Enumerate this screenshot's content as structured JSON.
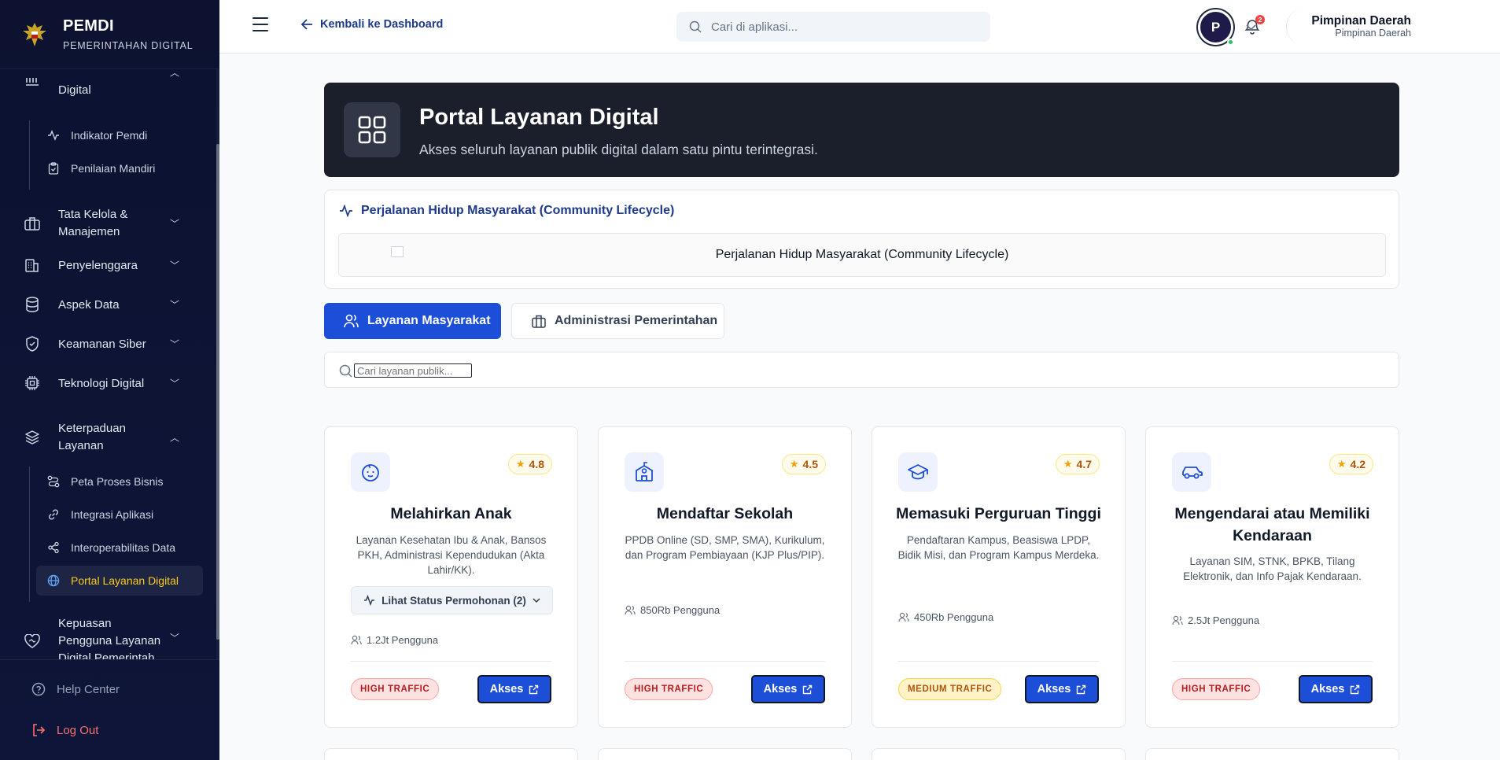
{
  "brand": {
    "name": "PEMDI",
    "subtitle": "PEMERINTAHAN DIGITAL"
  },
  "sidebar": {
    "partial_group": "Digital",
    "sub_group_1": [
      "Indikator Pemdi",
      "Penilaian Mandiri"
    ],
    "groups": {
      "tata_kelola": "Tata Kelola & Manajemen",
      "penyelenggara": "Penyelenggara",
      "aspek_data": "Aspek Data",
      "keamanan_siber": "Keamanan Siber",
      "teknologi_digital": "Teknologi Digital",
      "keterpaduan": "Keterpaduan Layanan",
      "kepuasan": "Kepuasan Pengguna Layanan Digital Pemerintah"
    },
    "sub_group_2": [
      "Peta Proses Bisnis",
      "Integrasi Aplikasi",
      "Interoperabilitas Data",
      "Portal Layanan Digital"
    ],
    "help": "Help Center",
    "logout": "Log Out"
  },
  "topbar": {
    "back_label": "Kembali ke Dashboard",
    "search_placeholder": "Cari di aplikasi...",
    "notif_count": "2",
    "user_name": "Pimpinan Daerah",
    "user_role": "Pimpinan Daerah",
    "avatar_initial": "P"
  },
  "hero": {
    "title": "Portal Layanan Digital",
    "subtitle": "Akses seluruh layanan publik digital dalam satu pintu terintegrasi."
  },
  "lifecycle": {
    "title": "Perjalanan Hidup Masyarakat (Community Lifecycle)",
    "image_alt": "Perjalanan Hidup Masyarakat (Community Lifecycle)"
  },
  "tabs": {
    "active": "Layanan Masyarakat",
    "other": "Administrasi Pemerintahan"
  },
  "service_search": {
    "placeholder": "Cari layanan publik..."
  },
  "colors": {
    "primary": "#1d4ed8",
    "sidebar": "#0c1230",
    "active_nav": "#facc15",
    "hero": "#1b1f2b"
  },
  "cards": [
    {
      "icon": "baby-icon",
      "rating": "4.8",
      "title": "Melahirkan Anak",
      "description": "Layanan Kesehatan Ibu & Anak, Bansos PKH, Administrasi Kependudukan (Akta Lahir/KK).",
      "status_button": "Lihat Status Permohonan (2)",
      "users": "1.2Jt Pengguna",
      "traffic": "HIGH TRAFFIC",
      "action": "Akses"
    },
    {
      "icon": "school-icon",
      "rating": "4.5",
      "title": "Mendaftar Sekolah",
      "description": "PPDB Online (SD, SMP, SMA), Kurikulum, dan Program Pembiayaan (KJP Plus/PIP).",
      "users": "850Rb Pengguna",
      "traffic": "HIGH TRAFFIC",
      "action": "Akses"
    },
    {
      "icon": "graduation-cap-icon",
      "rating": "4.7",
      "title": "Memasuki Perguruan Tinggi",
      "description": "Pendaftaran Kampus, Beasiswa LPDP, Bidik Misi, dan Program Kampus Merdeka.",
      "users": "450Rb Pengguna",
      "traffic": "MEDIUM TRAFFIC",
      "action": "Akses"
    },
    {
      "icon": "car-icon",
      "rating": "4.2",
      "title": "Mengendarai atau Memiliki Kendaraan",
      "description": "Layanan SIM, STNK, BPKB, Tilang Elektronik, dan Info Pajak Kendaraan.",
      "users": "2.5Jt Pengguna",
      "traffic": "HIGH TRAFFIC",
      "action": "Akses"
    }
  ]
}
